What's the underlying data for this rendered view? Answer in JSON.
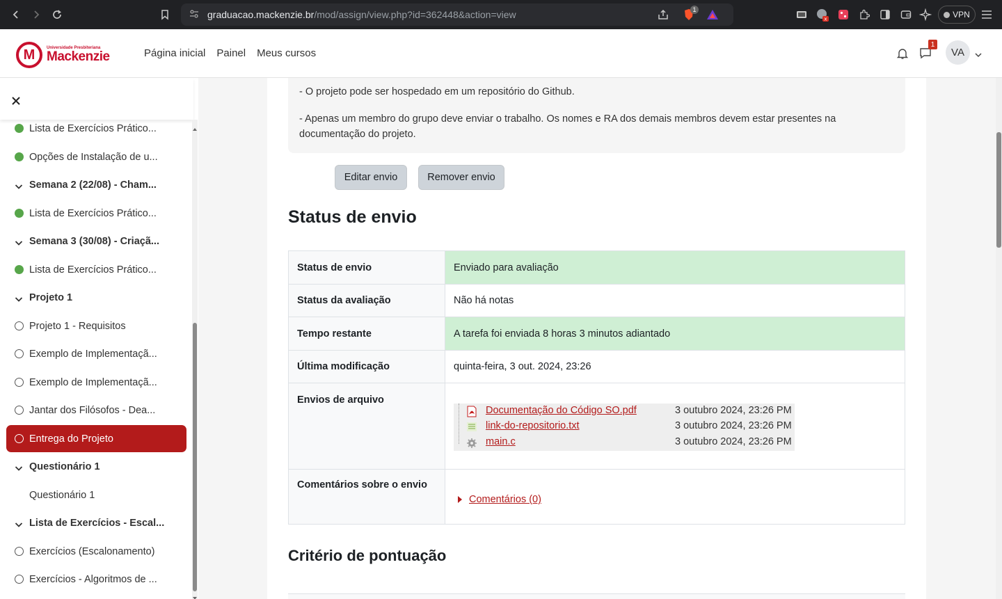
{
  "browser": {
    "url_host": "graduacao.mackenzie.br",
    "url_path": "/mod/assign/view.php?id=362448&action=view",
    "vpn_label": "VPN",
    "icons": [
      "back-icon",
      "forward-icon",
      "reload-icon",
      "bookmark-icon",
      "share-icon",
      "brave-shield-icon",
      "brave-rewards-icon",
      "extension-icon",
      "sidebar-icon",
      "wallet-icon",
      "leo-ai-icon",
      "menu-icon"
    ],
    "shield_badge": "1"
  },
  "header": {
    "logo_small": "Universidade Presbiteriana",
    "logo_big": "Mackenzie",
    "nav": [
      "Página inicial",
      "Painel",
      "Meus cursos"
    ],
    "message_badge": "1",
    "avatar": "VA"
  },
  "sidebar": {
    "items": [
      {
        "label": "Lista de Exercícios Prático...",
        "type": "done"
      },
      {
        "label": "Opções de Instalação de u...",
        "type": "done"
      },
      {
        "label": "Semana 2 (22/08) - Cham...",
        "type": "section"
      },
      {
        "label": "Lista de Exercícios Prático...",
        "type": "done"
      },
      {
        "label": "Semana 3 (30/08) - Criaçã...",
        "type": "section"
      },
      {
        "label": "Lista de Exercícios Prático...",
        "type": "done"
      },
      {
        "label": "Projeto 1",
        "type": "section"
      },
      {
        "label": "Projeto 1 - Requisitos",
        "type": "todo"
      },
      {
        "label": "Exemplo de Implementaçã...",
        "type": "todo"
      },
      {
        "label": "Exemplo de Implementaçã...",
        "type": "todo"
      },
      {
        "label": "Jantar dos Filósofos - Dea...",
        "type": "todo"
      },
      {
        "label": "Entrega do Projeto",
        "type": "active"
      },
      {
        "label": "Questionário 1",
        "type": "section"
      },
      {
        "label": "Questionário 1",
        "type": "plain"
      },
      {
        "label": "Lista de Exercícios - Escal...",
        "type": "section"
      },
      {
        "label": "Exercícios (Escalonamento)",
        "type": "todo"
      },
      {
        "label": "Exercícios - Algoritmos de ...",
        "type": "todo"
      }
    ]
  },
  "intro": {
    "line1": "- O projeto pode ser hospedado em um repositório do Github.",
    "line2": "- Apenas um membro do grupo deve enviar o trabalho. Os nomes e RA dos demais membros devem estar presentes na documentação do projeto."
  },
  "buttons": {
    "edit": "Editar envio",
    "remove": "Remover envio"
  },
  "status": {
    "heading": "Status de envio",
    "rows": [
      {
        "key": "Status de envio",
        "value": "Enviado para avaliação"
      },
      {
        "key": "Status da avaliação",
        "value": "Não há notas"
      },
      {
        "key": "Tempo restante",
        "value": "A tarefa foi enviada 8 horas 3 minutos adiantado"
      },
      {
        "key": "Última modificação",
        "value": "quinta-feira, 3 out. 2024, 23:26"
      },
      {
        "key": "Envios de arquivo",
        "value": ""
      },
      {
        "key": "Comentários sobre o envio",
        "value": ""
      }
    ],
    "files": [
      {
        "name": "Documentação do Código SO.pdf",
        "date": "3 outubro 2024, 23:26 PM",
        "icon": "pdf-icon"
      },
      {
        "name": "link-do-repositorio.txt",
        "date": "3 outubro 2024, 23:26 PM",
        "icon": "text-file-icon"
      },
      {
        "name": "main.c",
        "date": "3 outubro 2024, 23:26 PM",
        "icon": "source-file-icon"
      }
    ],
    "comments_link": "Comentários (0)"
  },
  "criteria": {
    "heading": "Critério de pontuação"
  },
  "colors": {
    "brand": "#b31b1b",
    "success_bg": "#cfefd4",
    "done": "#57a64a"
  }
}
